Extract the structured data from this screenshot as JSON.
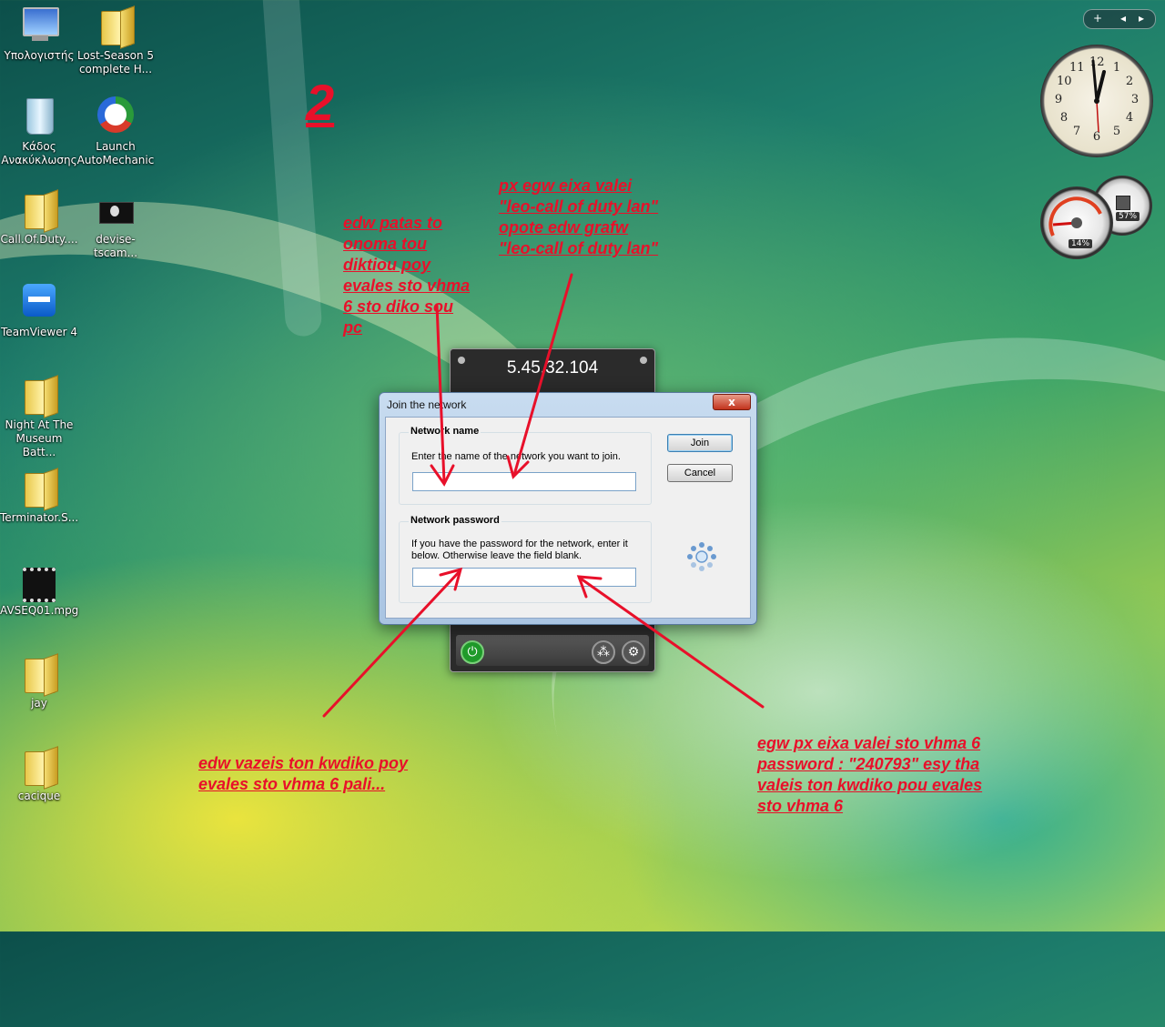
{
  "desktop_icons": [
    {
      "label": "Υπολογιστής",
      "icon": "computer-icon"
    },
    {
      "label": "Lost-Season 5 complete H...",
      "icon": "folder-icon"
    },
    {
      "label": "Κάδος Ανακύκλωσης",
      "icon": "recycle-bin-icon"
    },
    {
      "label": "Launch AutoMechanic",
      "icon": "automechanic-icon"
    },
    {
      "label": "Call.Of.Duty....",
      "icon": "folder-icon"
    },
    {
      "label": "devise-tscam...",
      "icon": "video-icon"
    },
    {
      "label": "TeamViewer 4",
      "icon": "teamviewer-icon"
    },
    {
      "label": "Night At The Museum Batt...",
      "icon": "folder-icon"
    },
    {
      "label": "Terminator.S...",
      "icon": "folder-icon"
    },
    {
      "label": "AVSEQ01.mpg",
      "icon": "video-file-icon"
    },
    {
      "label": "jay",
      "icon": "folder-icon"
    },
    {
      "label": "cacique",
      "icon": "folder-icon"
    }
  ],
  "annotations": {
    "step_number": "2",
    "network_name_hint": "edw patas to \nonoma tou \ndiktiou poy \nevales sto vhma \n6 sto diko sou \npc ",
    "example_name_hint": "px egw eixa valei \n\"leo-call of duty lan\" \nopote edw grafw \n\"leo-call of duty lan\"",
    "password_hint": "edw vazeis ton kwdiko poy \nevales sto vhma 6 pali...",
    "example_password_hint": "egw px eixa valei sto vhma 6 \npassword : \"240793\" esy tha \nvaleis ton kwdiko pou evales \nsto vhma 6"
  },
  "hamachi": {
    "ip": "5.45.32.104"
  },
  "dialog": {
    "title": "Join the network",
    "close_label": "x",
    "network_name": {
      "title": "Network name",
      "description": "Enter the name of the network you want to join.",
      "value": "",
      "placeholder": ""
    },
    "network_password": {
      "title": "Network password",
      "description": "If you have the password for the network, enter it below. Otherwise leave the field blank.",
      "value": "",
      "placeholder": ""
    },
    "join_label": "Join",
    "cancel_label": "Cancel"
  },
  "gadgets": {
    "clock_numbers": [
      "12",
      "1",
      "2",
      "3",
      "4",
      "5",
      "6",
      "7",
      "8",
      "9",
      "10",
      "11"
    ],
    "cpu_percent": "14%",
    "memory_percent": "57%",
    "sidebar_add": "+"
  },
  "colors": {
    "annotation": "#e8102a",
    "dialog_frame": "#a9c4e2",
    "hamachi_bg": "#2b2b2b"
  }
}
